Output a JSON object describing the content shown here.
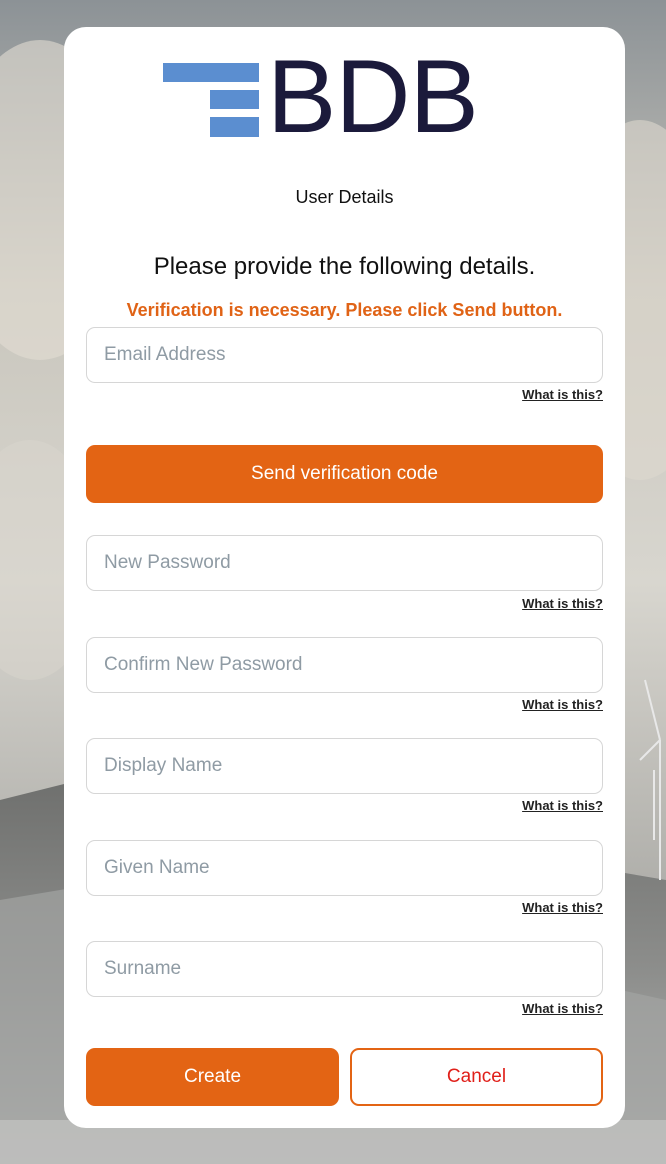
{
  "logo": {
    "text": "BDB"
  },
  "page": {
    "subtitle": "User Details",
    "heading": "Please provide the following details.",
    "warning": "Verification is necessary. Please click Send button."
  },
  "fields": {
    "email": {
      "placeholder": "Email Address",
      "help": "What is this?"
    },
    "new_password": {
      "placeholder": "New Password",
      "help": "What is this?"
    },
    "confirm_password": {
      "placeholder": "Confirm New Password",
      "help": "What is this?"
    },
    "display_name": {
      "placeholder": "Display Name",
      "help": "What is this?"
    },
    "given_name": {
      "placeholder": "Given Name",
      "help": "What is this?"
    },
    "surname": {
      "placeholder": "Surname",
      "help": "What is this?"
    }
  },
  "buttons": {
    "send": "Send verification code",
    "create": "Create",
    "cancel": "Cancel"
  },
  "colors": {
    "accent": "#e36414",
    "warning_text": "#e06316",
    "cancel_text": "#e0201a",
    "logo_bars": "#5b8ed0",
    "logo_text": "#1b1a3b"
  }
}
